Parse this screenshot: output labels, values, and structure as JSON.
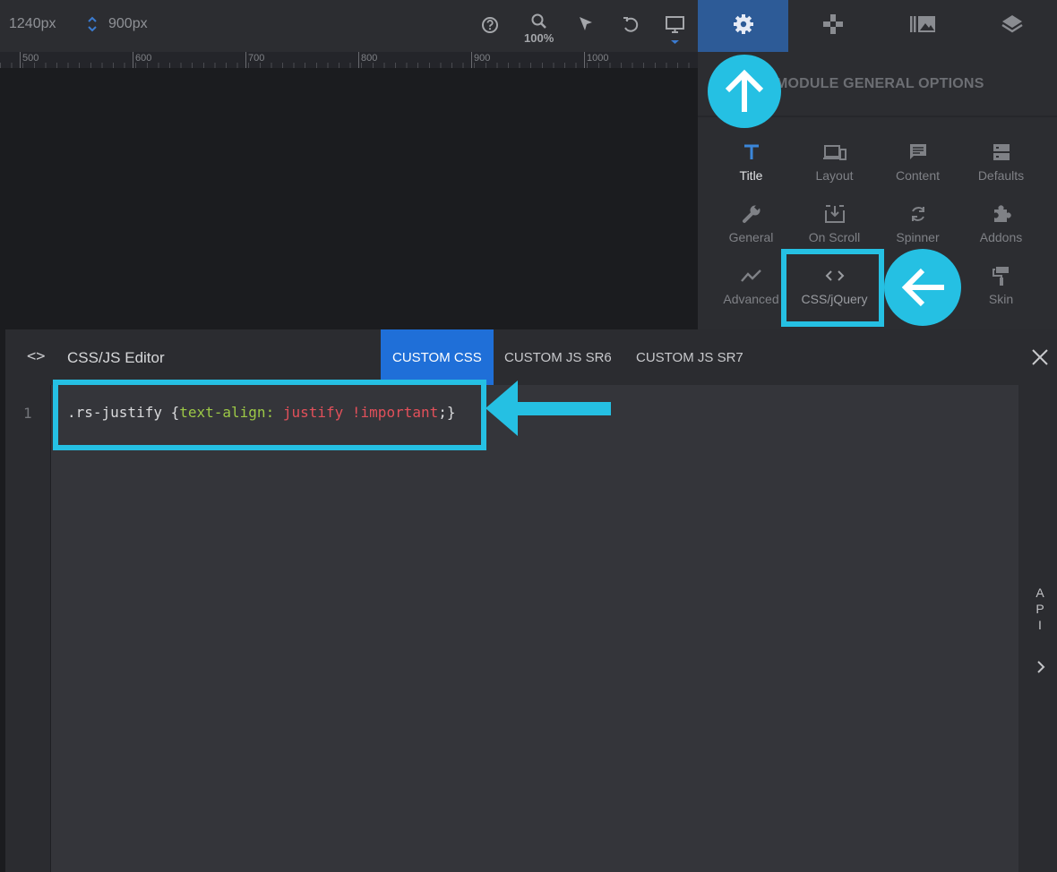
{
  "toolbar": {
    "width_value": "1240px",
    "height_value": "900px",
    "zoom": "100%",
    "icons": [
      "help-icon",
      "zoom-icon",
      "pointer-icon",
      "undo-icon",
      "desktop-icon"
    ]
  },
  "ruler": {
    "ticks": [
      "500",
      "600",
      "700",
      "800",
      "900",
      "1000"
    ]
  },
  "right_tabs": [
    "settings-icon",
    "gamepad-icon",
    "media-icon",
    "layers-icon"
  ],
  "panel": {
    "title": "MODULE GENERAL OPTIONS",
    "options": [
      {
        "label": "Title",
        "icon": "text-icon"
      },
      {
        "label": "Layout",
        "icon": "devices-icon"
      },
      {
        "label": "Content",
        "icon": "message-icon"
      },
      {
        "label": "Defaults",
        "icon": "server-icon"
      },
      {
        "label": "General",
        "icon": "wrench-icon"
      },
      {
        "label": "On Scroll",
        "icon": "download-icon"
      },
      {
        "label": "Spinner",
        "icon": "refresh-icon"
      },
      {
        "label": "Addons",
        "icon": "puzzle-icon"
      },
      {
        "label": "Advanced",
        "icon": "chart-icon"
      },
      {
        "label": "CSS/jQuery",
        "icon": "code-icon"
      },
      {
        "label": "",
        "icon": ""
      },
      {
        "label": "Skin",
        "icon": "paint-roller-icon"
      }
    ]
  },
  "editor": {
    "title": "CSS/JS Editor",
    "tabs": [
      "CUSTOM CSS",
      "CUSTOM JS SR6",
      "CUSTOM JS SR7"
    ],
    "line_number": "1",
    "code": {
      "selector": ".rs-justify {",
      "property": "text-align:",
      "value": "justify !important",
      "end": ";}"
    },
    "side_label": [
      "A",
      "P",
      "I"
    ]
  },
  "colors": {
    "accent": "#1f6fd8",
    "annotation": "#25c0e3",
    "active_tab": "#2d5b97"
  }
}
